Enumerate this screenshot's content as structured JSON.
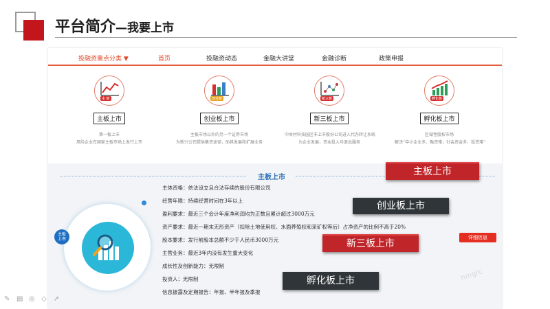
{
  "slide": {
    "title_main": "平台简介",
    "title_sub": "—我要上市"
  },
  "nav": {
    "items": [
      {
        "label": "投融资重点分类 ▼",
        "active": false
      },
      {
        "label": "首页",
        "active": true
      },
      {
        "label": "投融资动态",
        "active": false
      },
      {
        "label": "金融大讲堂",
        "active": false
      },
      {
        "label": "金融诊断",
        "active": false
      },
      {
        "label": "政策申报",
        "active": false
      }
    ]
  },
  "categories": [
    {
      "icon": "line-chart-icon",
      "tag": "主 板",
      "button": "主板上市",
      "desc1": "第一板上市",
      "desc2": "风险企业在国家主板市场上发行上市"
    },
    {
      "icon": "bar-chart-icon",
      "tag": "创业板",
      "button": "创业板上市",
      "desc1": "主板市场以外的另一个证券市场",
      "desc2": "为新兴公司提供集资途径，助其发展和扩展业务"
    },
    {
      "icon": "scatter-chart-icon",
      "tag": "新三板",
      "button": "新三板上市",
      "desc1": "中关村科技园区非上市股份公司进入代办转让系统",
      "desc2": "为企业发展，资本投入与退出服务"
    },
    {
      "icon": "growth-chart-icon",
      "tag": "孵化板",
      "button": "孵化板上市",
      "desc1": "区域性股权市场",
      "desc2": "解决“中小企业多、融资难；社会资金多、投资难”"
    }
  ],
  "detail": {
    "heading": "主板上市",
    "badge": "主板\n上市",
    "rows": [
      "主体资格：依法设立且合法存续的股份有限公司",
      "经营年限：持续经营时间在3年以上",
      "盈利要求：最近三个会计年度净利润均为正数且累计超过3000万元",
      "资产要求：最近一期末无形资产（扣除土地使用权、水面养殖权和采矿权等后）占净资产的比例不高于20%",
      "股本要求：发行前股本总额不少于人民币3000万元",
      "主营业务：最近3年内没有发生重大变化",
      "成长性及创新能力：无限制",
      "投资人：无限制",
      "信息披露及定期报告：年报、半年报及季报"
    ],
    "more_button": "详细信息"
  },
  "overlays": [
    {
      "label": "主板上市",
      "style": "red"
    },
    {
      "label": "创业板上市",
      "style": "dark"
    },
    {
      "label": "新三板上市",
      "style": "red"
    },
    {
      "label": "孵化板上市",
      "style": "dark"
    }
  ],
  "watermark": "nmgrc"
}
